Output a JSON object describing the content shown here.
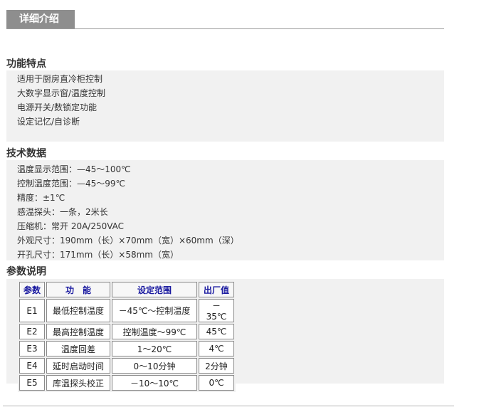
{
  "header": {
    "tab_label": "详细介绍"
  },
  "features": {
    "title": "功能特点",
    "items": [
      "适用于厨房直冷柜控制",
      "大数字显示窗/温度控制",
      "电源开关/数锁定功能",
      "设定记忆/自诊断"
    ]
  },
  "tech": {
    "title": "技术数据",
    "items": [
      "温度显示范围：—45～100℃",
      "控制温度范围：—45～99℃",
      "精度：±1℃",
      "感温探头：一条，2米长",
      "压缩机：常开 20A/250VAC",
      "外观尺寸：190mm（长）×70mm（宽）×60mm（深）",
      "开孔尺寸：171mm（长）×58mm（宽）"
    ]
  },
  "params": {
    "title": "参数说明",
    "headers": [
      "参数",
      "功　能",
      "设定范围",
      "出厂值"
    ],
    "rows": [
      [
        "E1",
        "最低控制温度",
        "－45℃～控制温度",
        "－35℃"
      ],
      [
        "E2",
        "最高控制温度",
        "控制温度～99℃",
        "45℃"
      ],
      [
        "E3",
        "温度回差",
        "1～20℃",
        "4℃"
      ],
      [
        "E4",
        "延时启动时间",
        "0～10分钟",
        "2分钟"
      ],
      [
        "E5",
        "库温探头校正",
        "－10～10℃",
        "0℃"
      ]
    ]
  }
}
